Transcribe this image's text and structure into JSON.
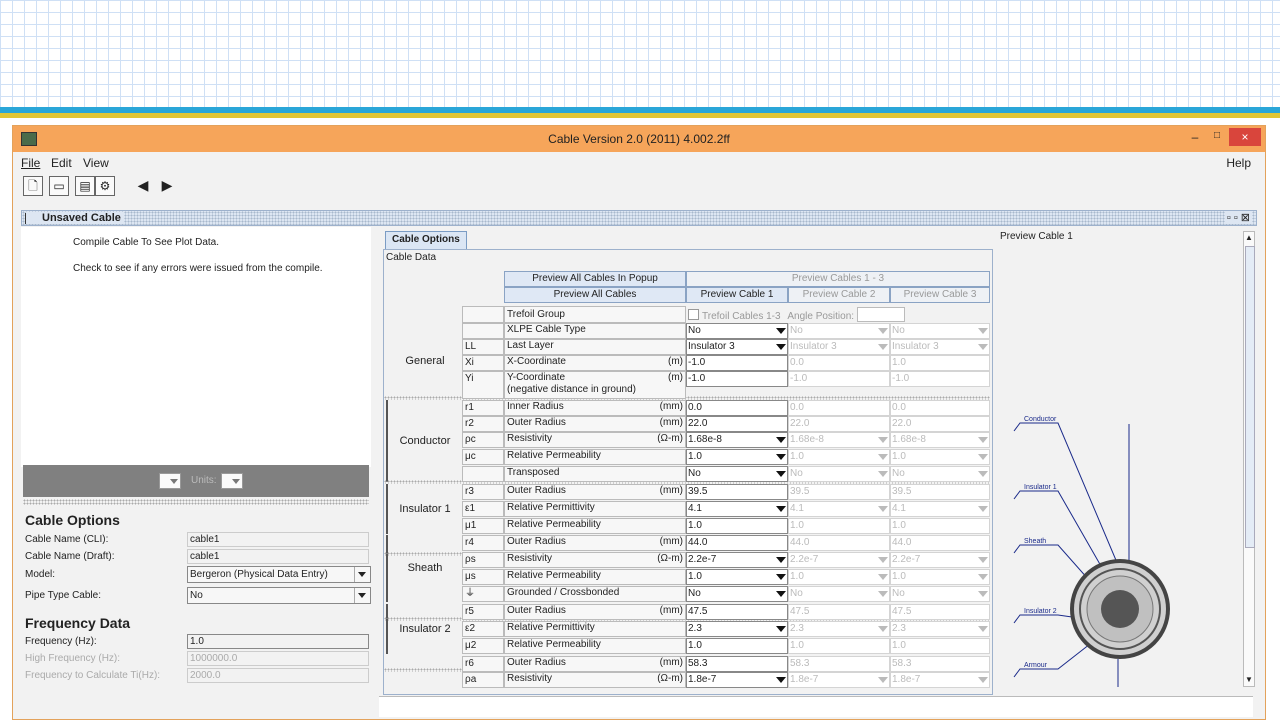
{
  "window": {
    "title": "Cable Version 2.0 (2011) 4.002.2ff",
    "minimize": "–",
    "maximize": "□",
    "close": "×"
  },
  "menu": {
    "file": "File",
    "edit": "Edit",
    "view": "View",
    "help": "Help"
  },
  "toolbar": {
    "icons": [
      "new-cable-icon",
      "open-icon",
      "save-icon",
      "settings-icon",
      "back-arrow-icon",
      "forward-arrow-icon"
    ]
  },
  "frame": {
    "title": "Unsaved Cable",
    "controls": "▫ ▫ ⊠"
  },
  "plot": {
    "msg1": "Compile Cable To See Plot Data.",
    "msg2": "Check to see if any errors were issued from the compile.",
    "units_label": "Units:"
  },
  "options": {
    "heading": "Cable Options",
    "cli_label": "Cable Name (CLI):",
    "cli_value": "cable1",
    "draft_label": "Cable Name (Draft):",
    "draft_value": "cable1",
    "model_label": "Model:",
    "model_value": "Bergeron (Physical Data Entry)",
    "pipe_label": "Pipe Type Cable:",
    "pipe_value": "No"
  },
  "frequency": {
    "heading": "Frequency Data",
    "freq_label": "Frequency (Hz):",
    "freq_value": "1.0",
    "high_label": "High Frequency (Hz):",
    "high_value": "1000000.0",
    "calc_label": "Frequency to Calculate Ti(Hz):",
    "calc_value": "2000.0"
  },
  "tabs": {
    "cable_options": "Cable Options",
    "cable_data": "Cable Data"
  },
  "buttons": {
    "preview_popup": "Preview All Cables In Popup",
    "preview_all": "Preview All Cables",
    "preview_1_3": "Preview Cables 1 - 3",
    "preview_c1": "Preview Cable 1",
    "preview_c2": "Preview Cable 2",
    "preview_c3": "Preview Cable 3"
  },
  "trefoil": {
    "label": "Trefoil Group",
    "check_label": "Trefoil Cables 1-3",
    "angle_label": "Angle Position:"
  },
  "groups": {
    "general": "General",
    "conductor": "Conductor",
    "insulator1": "Insulator 1",
    "sheath": "Sheath",
    "insulator2": "Insulator 2"
  },
  "rows": [
    {
      "sym": "",
      "name": "XLPE Cable Type",
      "unit": "",
      "v1": "No",
      "v2": "No",
      "v3": "No",
      "dd": true
    },
    {
      "sym": "LL",
      "name": "Last Layer",
      "unit": "",
      "v1": "Insulator 3",
      "v2": "Insulator 3",
      "v3": "Insulator 3",
      "dd": true
    },
    {
      "sym": "Xi",
      "name": "X-Coordinate",
      "unit": "(m)",
      "v1": "-1.0",
      "v2": "0.0",
      "v3": "1.0",
      "dd": false
    },
    {
      "sym": "Yi",
      "name": "Y-Coordinate",
      "name2": "(negative distance in ground)",
      "unit": "(m)",
      "v1": "-1.0",
      "v2": "-1.0",
      "v3": "-1.0",
      "dd": false
    },
    {
      "sym": "r1",
      "name": "Inner Radius",
      "unit": "(mm)",
      "v1": "0.0",
      "v2": "0.0",
      "v3": "0.0",
      "dd": false
    },
    {
      "sym": "r2",
      "name": "Outer Radius",
      "unit": "(mm)",
      "v1": "22.0",
      "v2": "22.0",
      "v3": "22.0",
      "dd": false
    },
    {
      "sym": "ρc",
      "name": "Resistivity",
      "unit": "(Ω-m)",
      "v1": "1.68e-8",
      "v2": "1.68e-8",
      "v3": "1.68e-8",
      "dd": true
    },
    {
      "sym": "μc",
      "name": "Relative Permeability",
      "unit": "",
      "v1": "1.0",
      "v2": "1.0",
      "v3": "1.0",
      "dd": true
    },
    {
      "sym": "",
      "name": "Transposed",
      "unit": "",
      "v1": "No",
      "v2": "No",
      "v3": "No",
      "dd": true
    },
    {
      "sym": "r3",
      "name": "Outer Radius",
      "unit": "(mm)",
      "v1": "39.5",
      "v2": "39.5",
      "v3": "39.5",
      "dd": false
    },
    {
      "sym": "ε1",
      "name": "Relative Permittivity",
      "unit": "",
      "v1": "4.1",
      "v2": "4.1",
      "v3": "4.1",
      "dd": true
    },
    {
      "sym": "μ1",
      "name": "Relative Permeability",
      "unit": "",
      "v1": "1.0",
      "v2": "1.0",
      "v3": "1.0",
      "dd": false
    },
    {
      "sym": "r4",
      "name": "Outer Radius",
      "unit": "(mm)",
      "v1": "44.0",
      "v2": "44.0",
      "v3": "44.0",
      "dd": false
    },
    {
      "sym": "ρs",
      "name": "Resistivity",
      "unit": "(Ω-m)",
      "v1": "2.2e-7",
      "v2": "2.2e-7",
      "v3": "2.2e-7",
      "dd": true
    },
    {
      "sym": "μs",
      "name": "Relative Permeability",
      "unit": "",
      "v1": "1.0",
      "v2": "1.0",
      "v3": "1.0",
      "dd": true
    },
    {
      "sym": "⏚",
      "name": "Grounded / Crossbonded",
      "unit": "",
      "v1": "No",
      "v2": "No",
      "v3": "No",
      "dd": true
    },
    {
      "sym": "r5",
      "name": "Outer Radius",
      "unit": "(mm)",
      "v1": "47.5",
      "v2": "47.5",
      "v3": "47.5",
      "dd": false
    },
    {
      "sym": "ε2",
      "name": "Relative Permittivity",
      "unit": "",
      "v1": "2.3",
      "v2": "2.3",
      "v3": "2.3",
      "dd": true
    },
    {
      "sym": "μ2",
      "name": "Relative Permeability",
      "unit": "",
      "v1": "1.0",
      "v2": "1.0",
      "v3": "1.0",
      "dd": false
    },
    {
      "sym": "r6",
      "name": "Outer Radius",
      "unit": "(mm)",
      "v1": "58.3",
      "v2": "58.3",
      "v3": "58.3",
      "dd": false
    },
    {
      "sym": "ρa",
      "name": "Resistivity",
      "unit": "(Ω-m)",
      "v1": "1.8e-7",
      "v2": "1.8e-7",
      "v3": "1.8e-7",
      "dd": true
    }
  ],
  "preview": {
    "title": "Preview Cable 1",
    "labels": {
      "conductor": "Conductor",
      "insulator1": "Insulator 1",
      "sheath": "Sheath",
      "insulator2": "Insulator 2",
      "armour": "Armour"
    },
    "colors": {
      "line": "#1a2a8a",
      "ring_dark": "#444444",
      "ring_mid": "#a0a0a0",
      "ring_light": "#c8c8c8"
    }
  }
}
